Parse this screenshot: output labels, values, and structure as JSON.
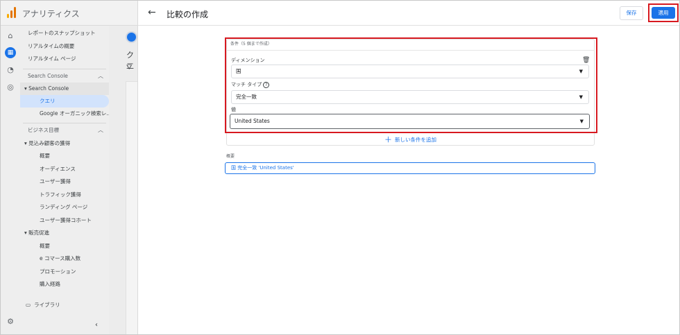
{
  "app": {
    "title": "アナリティクス",
    "logo_colors": [
      "#f9ab00",
      "#e37400",
      "#e37400"
    ]
  },
  "rail": {
    "icons": [
      "home-icon",
      "reports-icon",
      "explore-icon",
      "advertising-icon",
      "settings-icon"
    ]
  },
  "sidebar": {
    "top_items": [
      "レポートのスナップショット",
      "リアルタイムの概要",
      "リアルタイム ページ"
    ],
    "search_console_section": "Search Console",
    "search_console_group": "Search Console",
    "search_console_items": [
      "クエリ",
      "Google オーガニック検索レ..."
    ],
    "business_section": "ビジネス目標",
    "acquisition_group": "見込み顧客の獲得",
    "acquisition_items": [
      "概要",
      "オーディエンス",
      "ユーザー獲得",
      "トラフィック獲得",
      "ランディング ページ",
      "ユーザー獲得コホート"
    ],
    "sales_group": "販売促進",
    "sales_items": [
      "概要",
      "e コマース購入数",
      "プロモーション",
      "購入経路"
    ],
    "library": "ライブラリ"
  },
  "peek": {
    "title_fragment": "ク二"
  },
  "panel": {
    "title": "比較の作成",
    "save_label": "保存",
    "apply_label": "適用",
    "conditions_label": "条件（5 個まで作成）",
    "dimension_label": "ディメンション",
    "dimension_value": "国",
    "match_type_label": "マッチ タイプ",
    "match_type_value": "完全一致",
    "value_label": "値",
    "value_value": "United States",
    "add_condition_label": "新しい条件を追加",
    "summary_label": "概要",
    "summary_value": "国 完全一致 'United States'"
  },
  "colors": {
    "accent": "#1a73e8",
    "highlight": "#d71920"
  }
}
